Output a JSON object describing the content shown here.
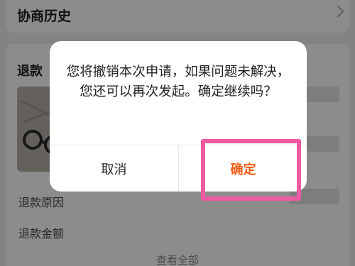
{
  "background": {
    "history_title": "协商历史",
    "refund_title": "退款",
    "refund_reason_label": "退款原因",
    "refund_amount_label": "退款金额",
    "see_all": "查看全部",
    "chevron_icon": "chevron-right-icon"
  },
  "dialog": {
    "message": "您将撤销本次申请，如果问题未解决，您还可以再次发起。确定继续吗？",
    "cancel_label": "取消",
    "confirm_label": "确定",
    "confirm_color": "#f25a11"
  },
  "annotation": {
    "highlight_color": "#f05aa5"
  }
}
